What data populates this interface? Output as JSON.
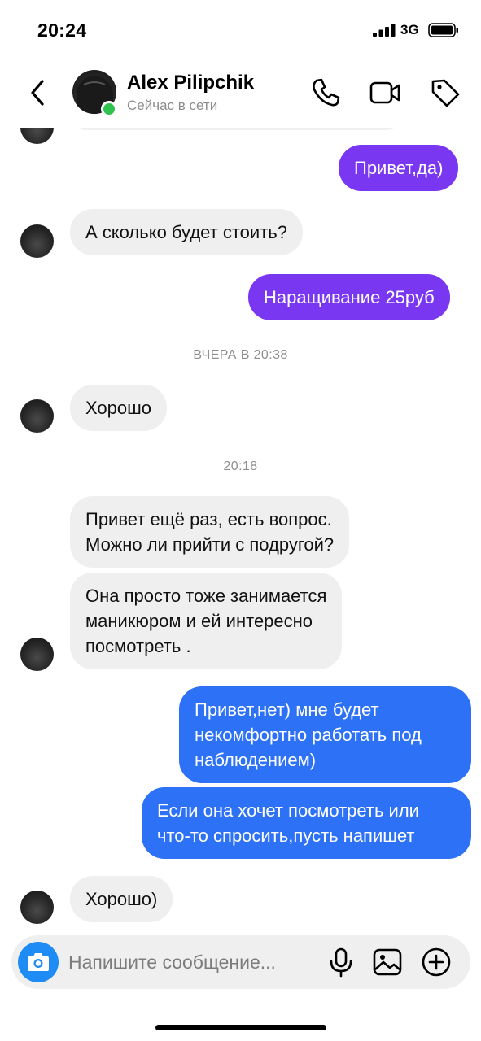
{
  "status_bar": {
    "time": "20:24",
    "network": "3G"
  },
  "header": {
    "contact_name": "Alex Pilipchik",
    "contact_status": "Сейчас в сети",
    "icons": [
      "back-chevron-icon",
      "phone-icon",
      "video-camera-icon",
      "tag-icon"
    ]
  },
  "messages": [
    {
      "from": "me",
      "text": "Привет,да)"
    },
    {
      "from": "contact",
      "text": "А сколько будет стоить?"
    },
    {
      "from": "me",
      "text": "Наращивание 25руб"
    },
    {
      "type": "timestamp",
      "text": "ВЧЕРА В 20:38"
    },
    {
      "from": "contact",
      "text": "Хорошо"
    },
    {
      "type": "timestamp",
      "text": "20:18"
    },
    {
      "from": "contact",
      "lines": [
        "Привет ещё раз, есть вопрос.",
        "Можно ли прийти с подругой?"
      ]
    },
    {
      "from": "contact",
      "lines": [
        "Она просто тоже занимается",
        "маникюром и ей интересно",
        "посмотреть ."
      ]
    },
    {
      "from": "me",
      "lines": [
        "Привет,нет) мне будет",
        "некомфортно работать под",
        "наблюдением)"
      ]
    },
    {
      "from": "me",
      "lines": [
        "Если она хочет посмотреть или",
        "что-то спросить,пусть напишет"
      ]
    },
    {
      "from": "contact",
      "text": "Хорошо)"
    }
  ],
  "composer": {
    "placeholder": "Напишите сообщение...",
    "icons": [
      "camera-icon",
      "microphone-icon",
      "gallery-icon",
      "add-icon"
    ]
  },
  "colors": {
    "accent_purple": "#7a37f2",
    "accent_blue": "#2c71f6",
    "incoming_bubble": "#efefef",
    "online": "#2ec24e",
    "camera_button": "#1f8cf5"
  }
}
